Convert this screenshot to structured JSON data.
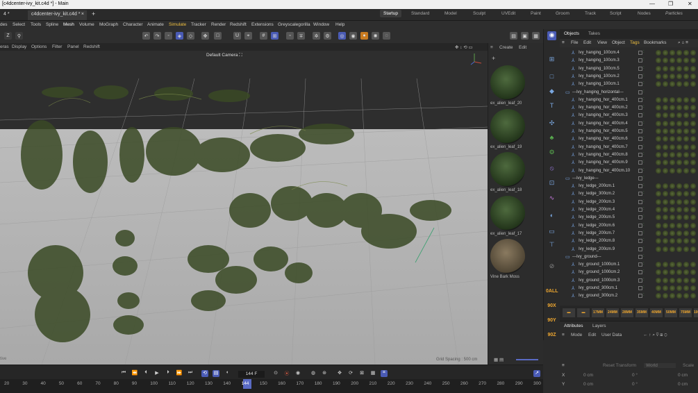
{
  "window": {
    "title": "[c4dcenter-ivy_kit.c4d *] - Main",
    "min": "—",
    "max": "❐",
    "close": "✕"
  },
  "tabs": {
    "left": "4 *",
    "doc": "c4dcenter-ivy_kit.c4d *",
    "close": "×",
    "add": "+"
  },
  "layouts": [
    "Startup",
    "Standard",
    "Model",
    "Sculpt",
    "UVEdit",
    "Paint",
    "Groom",
    "Track",
    "Script",
    "Nodes",
    "Particles"
  ],
  "menu": [
    "des",
    "Select",
    "Tools",
    "Spline",
    "Mesh",
    "Volume",
    "MoGraph",
    "Character",
    "Animate",
    "Simulate",
    "Tracker",
    "Render",
    "Redshift",
    "Extensions",
    "Greyscalegorilla",
    "Window",
    "Help"
  ],
  "viewport_menu": [
    "eras",
    "Display",
    "Options",
    "Filter",
    "Panel",
    "Redshift"
  ],
  "viewport": {
    "camera": "Default Camera ⛶",
    "grid_spacing": "Grid Spacing : 500 cm",
    "corner": "tive"
  },
  "assets": {
    "tabs": [
      "Create",
      "Edit"
    ],
    "items": [
      "ex_alien_leaf_20",
      "ex_alien_leaf_19",
      "ex_alien_leaf_18",
      "ex_alien_leaf_17",
      "Vine Bark Moss"
    ]
  },
  "objects": {
    "tabs": [
      "Objects",
      "Takes"
    ],
    "menu": [
      "File",
      "Edit",
      "View",
      "Object",
      "Tags",
      "Bookmarks"
    ],
    "rows": [
      {
        "name": "Ivy_hanging_100cm.4",
        "group": false
      },
      {
        "name": "Ivy_hanging_100cm.3",
        "group": false
      },
      {
        "name": "Ivy_hanging_100cm.5",
        "group": false
      },
      {
        "name": "Ivy_hanging_100cm.2",
        "group": false
      },
      {
        "name": "Ivy_hanging_100cm.1",
        "group": false
      },
      {
        "name": "---Ivy_hanging_horizontal---",
        "group": true
      },
      {
        "name": "Ivy_hanging_hor_400cm.1",
        "group": false
      },
      {
        "name": "Ivy_hanging_hor_400cm.2",
        "group": false
      },
      {
        "name": "Ivy_hanging_hor_400cm.3",
        "group": false
      },
      {
        "name": "Ivy_hanging_hor_400cm.4",
        "group": false
      },
      {
        "name": "Ivy_hanging_hor_400cm.5",
        "group": false
      },
      {
        "name": "Ivy_hanging_hor_400cm.6",
        "group": false
      },
      {
        "name": "Ivy_hanging_hor_400cm.7",
        "group": false
      },
      {
        "name": "Ivy_hanging_hor_400cm.8",
        "group": false
      },
      {
        "name": "Ivy_hanging_hor_400cm.9",
        "group": false
      },
      {
        "name": "Ivy_hanging_hor_400cm.10",
        "group": false
      },
      {
        "name": "---Ivy_ledge---",
        "group": true
      },
      {
        "name": "Ivy_ledge_200cm.1",
        "group": false
      },
      {
        "name": "Ivy_ledge_300cm.2",
        "group": false
      },
      {
        "name": "Ivy_ledge_200cm.3",
        "group": false
      },
      {
        "name": "Ivy_ledge_200cm.4",
        "group": false
      },
      {
        "name": "Ivy_ledge_200cm.5",
        "group": false
      },
      {
        "name": "Ivy_ledge_200cm.6",
        "group": false
      },
      {
        "name": "Ivy_ledge_200cm.7",
        "group": false
      },
      {
        "name": "Ivy_ledge_200cm.8",
        "group": false
      },
      {
        "name": "Ivy_ledge_200cm.9",
        "group": false
      },
      {
        "name": "---Ivy_ground---",
        "group": true
      },
      {
        "name": "Ivy_ground_1000cm.1",
        "group": false
      },
      {
        "name": "Ivy_ground_1000cm.2",
        "group": false
      },
      {
        "name": "Ivy_ground_1000cm.3",
        "group": false
      },
      {
        "name": "Ivy_ground_300cm.1",
        "group": false
      },
      {
        "name": "Ivy_ground_300cm.2",
        "group": false
      }
    ]
  },
  "camera_strip": [
    "17MM",
    "24MM",
    "28MM",
    "35MM",
    "40MM",
    "50MM",
    "75MM",
    "100"
  ],
  "axis_buttons": [
    "0ALL",
    "90X",
    "90Y",
    "90Z"
  ],
  "attributes": {
    "tabs": [
      "Attributes",
      "Layers"
    ],
    "menu": [
      "Mode",
      "Edit",
      "User Data"
    ],
    "reset": "Reset Transform",
    "world": "World",
    "scale": "Scale",
    "x_label": "X",
    "y_label": "Y",
    "zero_cm": "0 cm",
    "zero_deg": "0 °"
  },
  "timeline": {
    "frame": "144 F",
    "ticks": [
      "20",
      "30",
      "40",
      "50",
      "60",
      "70",
      "80",
      "90",
      "100",
      "110",
      "120",
      "130",
      "140",
      "144",
      "150",
      "160",
      "170",
      "180",
      "190",
      "200",
      "210",
      "220",
      "230",
      "240",
      "250",
      "260",
      "270",
      "280",
      "290",
      "300"
    ]
  }
}
